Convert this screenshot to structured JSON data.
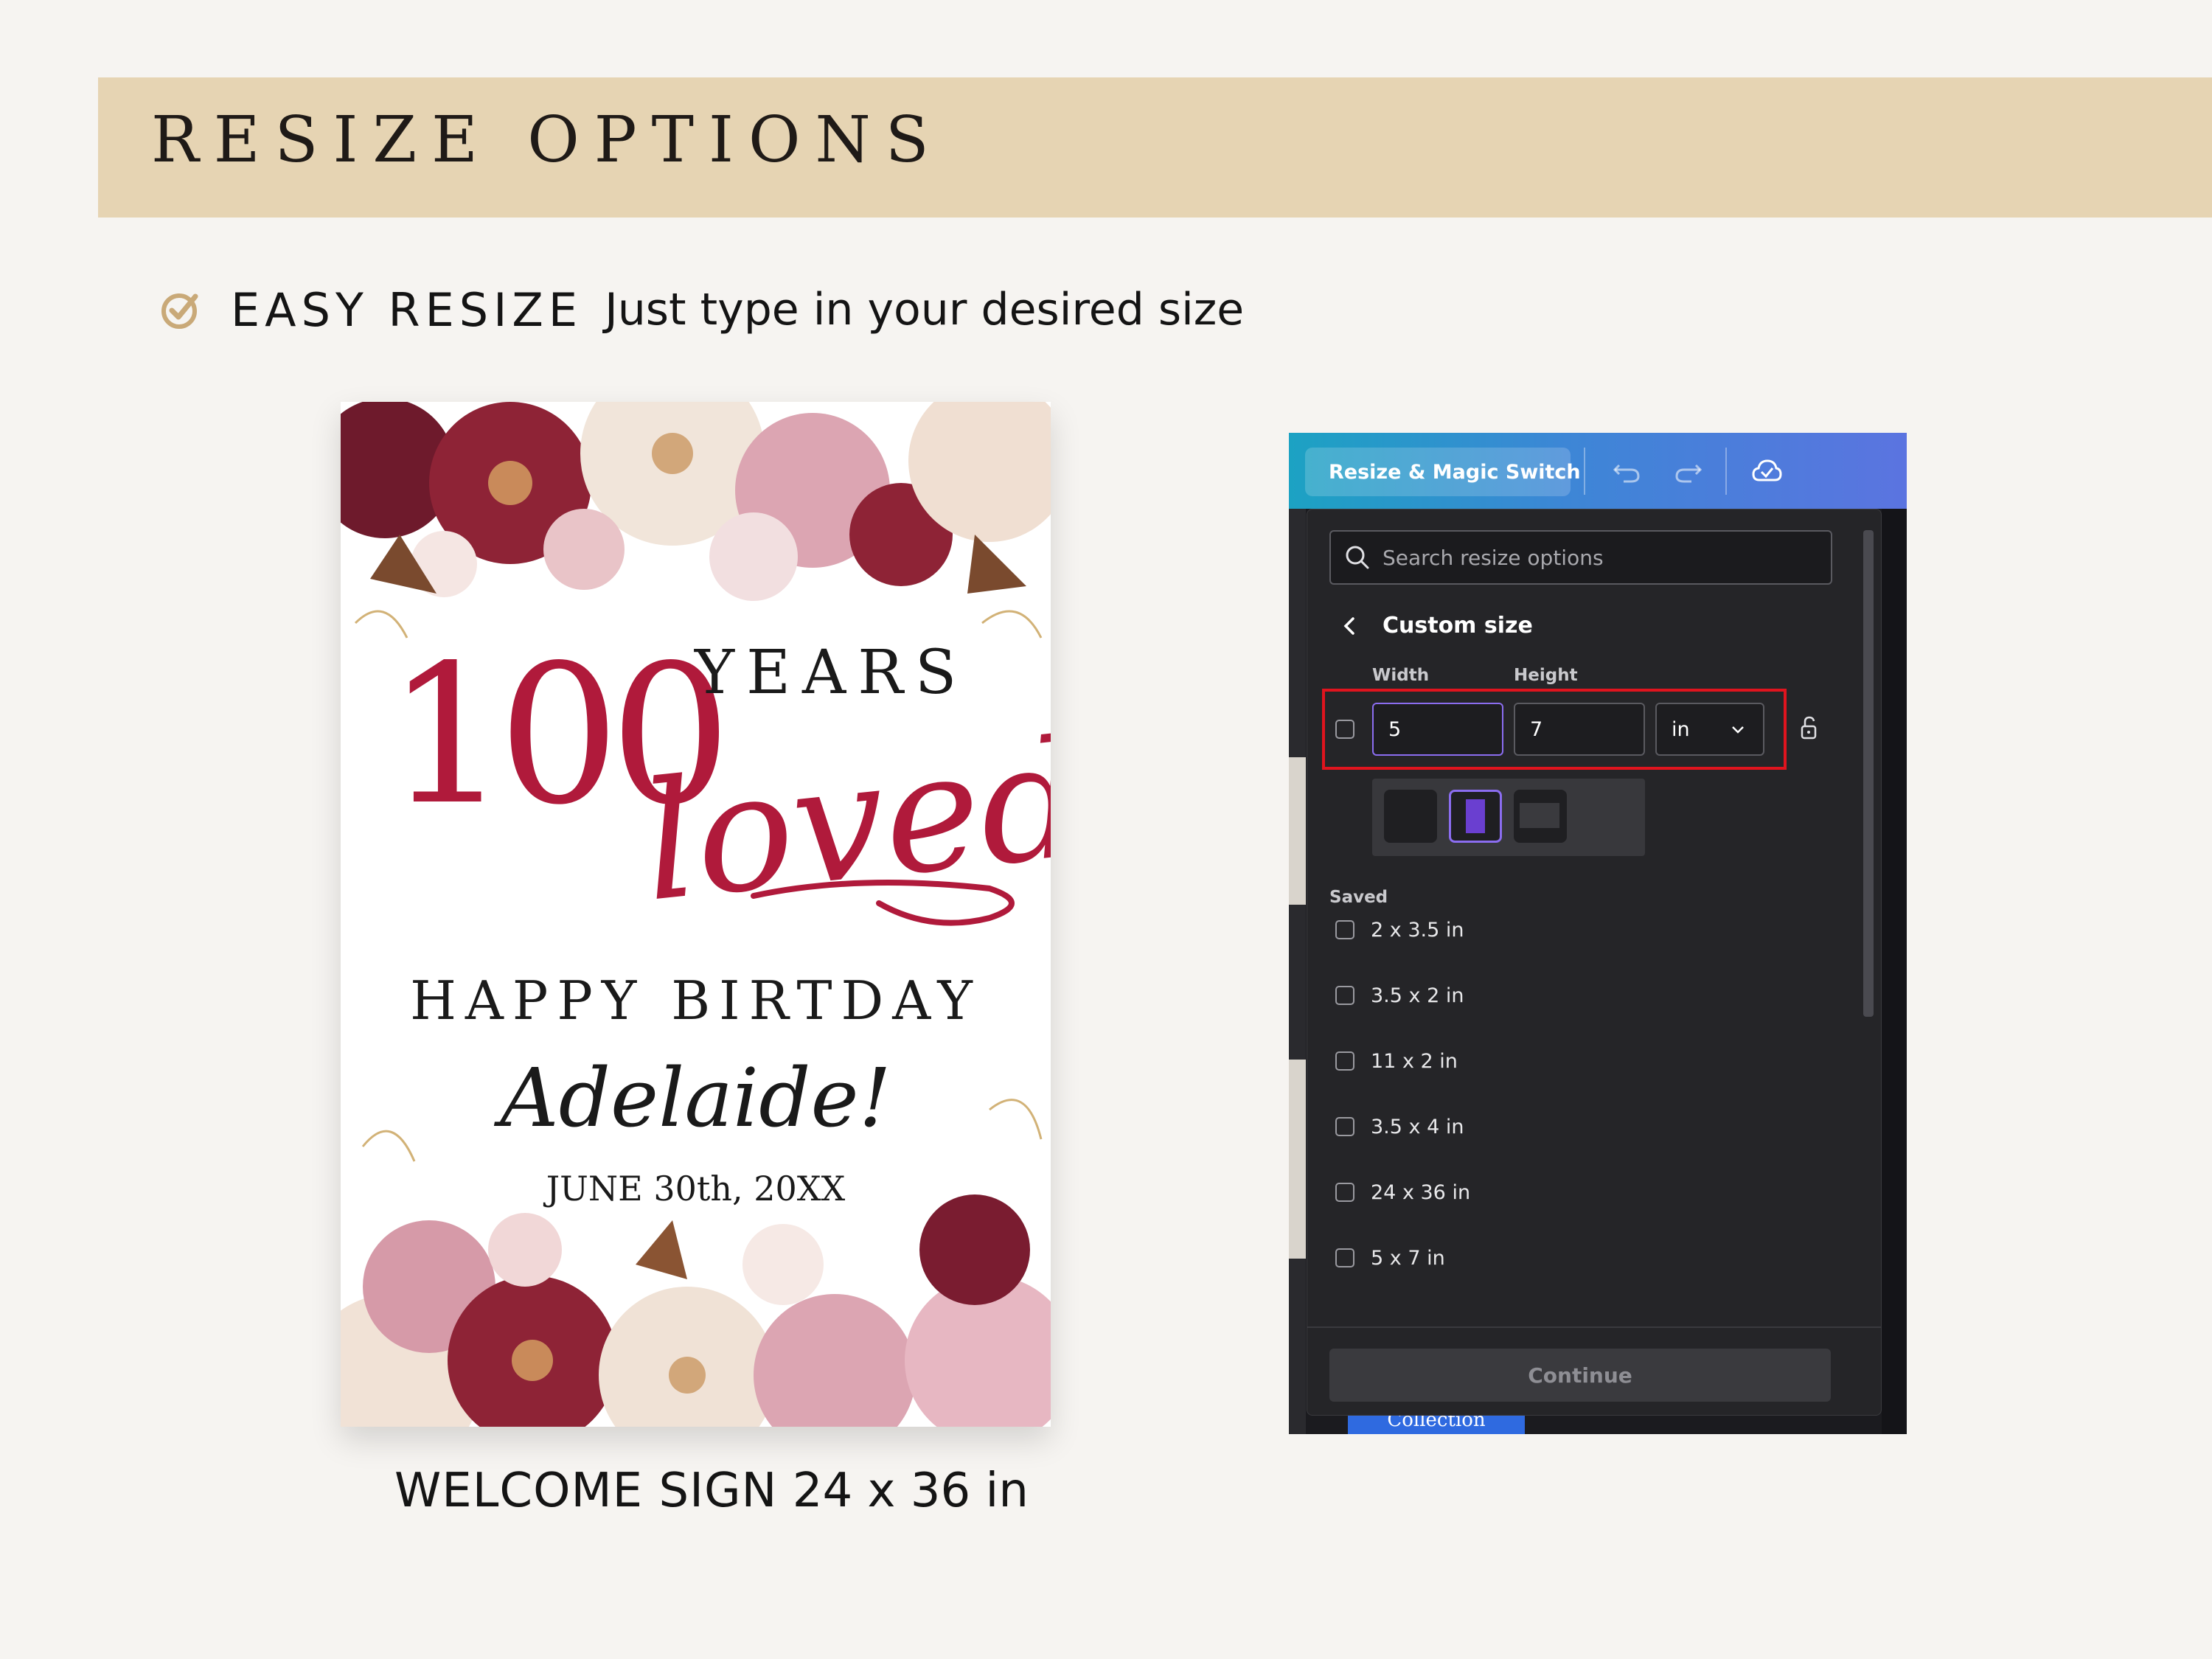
{
  "banner": {
    "title": "RESIZE OPTIONS"
  },
  "feature": {
    "title": "EASY RESIZE",
    "description": "Just type in your desired size"
  },
  "poster": {
    "hundred": "100",
    "years": "YEARS",
    "loved": "loved",
    "happy_birthday": "HAPPY BIRTDAY",
    "name": "Adelaide!",
    "date": "JUNE 30th, 20XX"
  },
  "caption": {
    "title": "WELCOME SIGN",
    "size": "24 x 36 in"
  },
  "editor": {
    "toolbar": {
      "resize_label": "Resize & Magic Switch"
    },
    "search": {
      "placeholder": "Search resize options"
    },
    "custom_size": {
      "title": "Custom size",
      "width_label": "Width",
      "height_label": "Height",
      "width_value": "5",
      "height_value": "7",
      "unit": "in"
    },
    "saved": {
      "label": "Saved",
      "items": [
        {
          "label": "2 x 3.5 in"
        },
        {
          "label": "3.5 x 2 in"
        },
        {
          "label": "11 x 2 in"
        },
        {
          "label": "3.5 x 4 in"
        },
        {
          "label": "24 x 36 in"
        },
        {
          "label": "5 x 7 in"
        }
      ]
    },
    "continue_label": "Continue",
    "background_text": "Collection"
  },
  "colors": {
    "banner": "#e6d4b3",
    "accent_red": "#b01a3b",
    "highlight": "#e0141e",
    "selected_purple": "#8b6df0"
  }
}
